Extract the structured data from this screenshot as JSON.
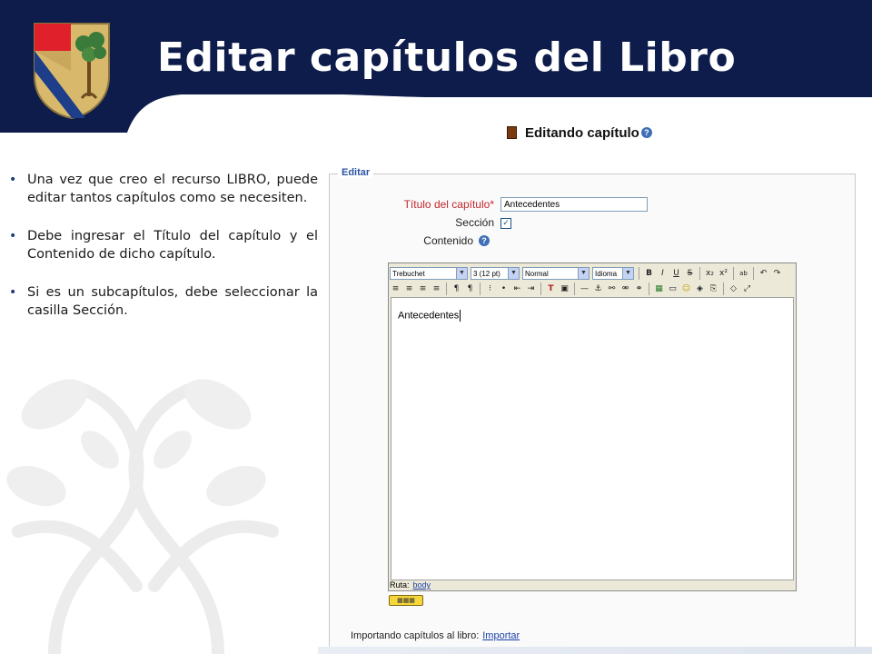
{
  "slide": {
    "title": "Editar capítulos del Libro",
    "colors": {
      "navy": "#0d1c4a",
      "bullet": "#1f3a70",
      "crest_red": "#e0202a",
      "crest_blue": "#1e3e8a",
      "crest_gold": "#d8b96c"
    },
    "bullets": [
      "Una vez que creo el recurso LIBRO, puede editar tantos capítulos como se necesiten.",
      "Debe ingresar el Título del capítulo y el Contenido de dicho capítulo.",
      "Si es un subcapítulos, debe seleccionar la casilla Sección."
    ]
  },
  "screenshot": {
    "heading": "Editando capítulo",
    "legend": "Editar",
    "fields": {
      "title_label": "Título del capítulo*",
      "title_value": "Antecedentes",
      "section_label": "Sección",
      "section_checked": true,
      "content_label": "Contenido"
    },
    "toolbar": {
      "font": "Trebuchet",
      "size": "3 (12 pt)",
      "format": "Normal",
      "language": "Idioma",
      "row1_buttons": [
        "B",
        "I",
        "U",
        "S",
        "x₂",
        "x²",
        "ab",
        "↶",
        "↷"
      ],
      "row2_buttons": [
        "≡",
        "≡",
        "≡",
        "≡",
        "¶",
        "¶",
        "⁝",
        "•",
        "⇤",
        "⇥",
        "T",
        "▣",
        "—",
        "⚓",
        "⚯",
        "⚮",
        "⚭",
        "▦",
        "▭",
        "☺",
        "◈",
        "⎘",
        "◇",
        "⤢"
      ]
    },
    "editor_text": "Antecedentes",
    "path_label": "Ruta:",
    "path_link": "body",
    "import_label": "Importando capítulos al libro:",
    "import_link": "Importar"
  }
}
